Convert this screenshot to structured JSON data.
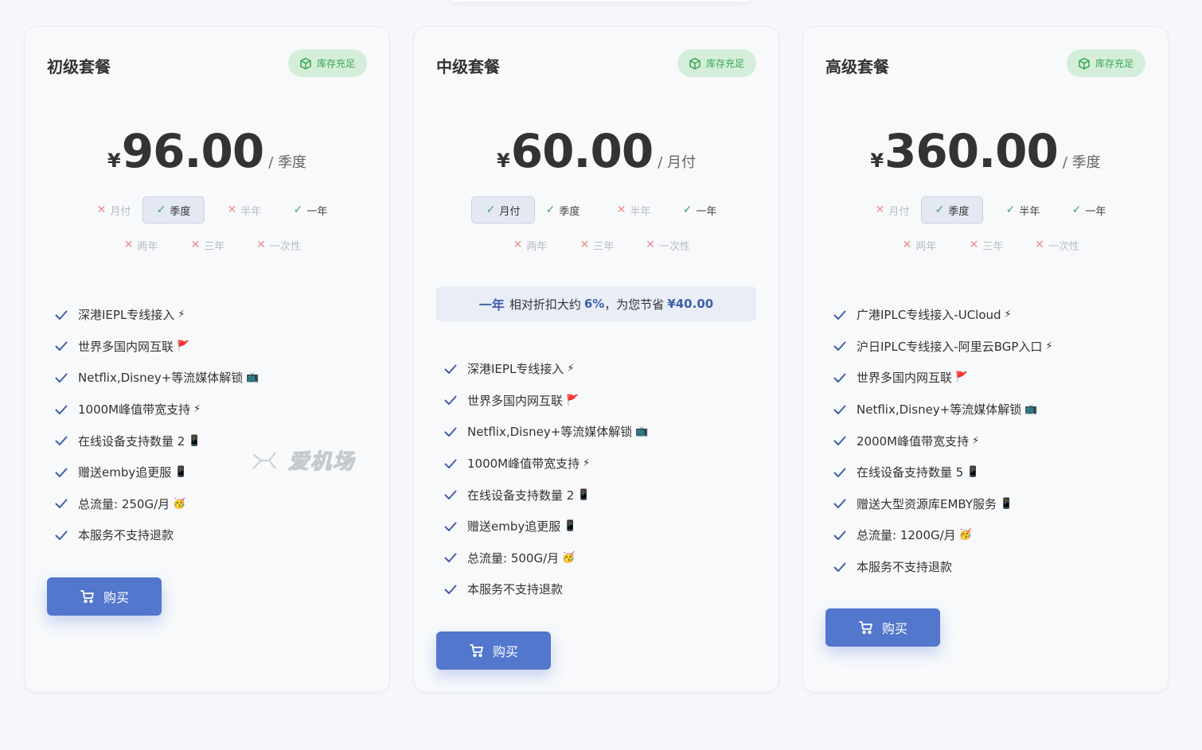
{
  "stock_label": "库存充足",
  "currency": "¥",
  "buy_label": "购买",
  "colors": {
    "accent": "#5277cc",
    "stock": "#3aa757",
    "unavailable": "#f08c8c"
  },
  "watermark": "爱机场",
  "plans": [
    {
      "title": "初级套餐",
      "price": "96.00",
      "period": "/ 季度",
      "cycles_row1": [
        {
          "label": "月付",
          "available": false,
          "active": false
        },
        {
          "label": "季度",
          "available": true,
          "active": true
        },
        {
          "label": "半年",
          "available": false,
          "active": false
        },
        {
          "label": "一年",
          "available": true,
          "active": false
        }
      ],
      "cycles_row2": [
        {
          "label": "两年",
          "available": false,
          "active": false
        },
        {
          "label": "三年",
          "available": false,
          "active": false
        },
        {
          "label": "一次性",
          "available": false,
          "active": false
        }
      ],
      "features": [
        {
          "text": "深港IEPL专线接入",
          "emoji": "⚡"
        },
        {
          "text": "世界多国内网互联",
          "emoji": "🚩"
        },
        {
          "text": "Netflix,Disney+等流媒体解锁",
          "emoji": "📺"
        },
        {
          "text": "1000M峰值带宽支持",
          "emoji": "⚡"
        },
        {
          "text": "在线设备支持数量 2",
          "emoji": "📱"
        },
        {
          "text": "赠送emby追更服",
          "emoji": "📱"
        },
        {
          "text": "总流量: 250G/月",
          "emoji": "🥳"
        },
        {
          "text": "本服务不支持退款",
          "emoji": ""
        }
      ]
    },
    {
      "title": "中级套餐",
      "price": "60.00",
      "period": "/ 月付",
      "cycles_row1": [
        {
          "label": "月付",
          "available": true,
          "active": true
        },
        {
          "label": "季度",
          "available": true,
          "active": false
        },
        {
          "label": "半年",
          "available": false,
          "active": false
        },
        {
          "label": "一年",
          "available": true,
          "active": false
        }
      ],
      "cycles_row2": [
        {
          "label": "两年",
          "available": false,
          "active": false
        },
        {
          "label": "三年",
          "available": false,
          "active": false
        },
        {
          "label": "一次性",
          "available": false,
          "active": false
        }
      ],
      "discount": {
        "cycle": "一年",
        "text1": "相对折扣大约",
        "percent": "6%",
        "text2": "，为您节省",
        "amount": "¥40.00"
      },
      "features": [
        {
          "text": "深港IEPL专线接入",
          "emoji": "⚡"
        },
        {
          "text": "世界多国内网互联",
          "emoji": "🚩"
        },
        {
          "text": "Netflix,Disney+等流媒体解锁",
          "emoji": "📺"
        },
        {
          "text": "1000M峰值带宽支持",
          "emoji": "⚡"
        },
        {
          "text": "在线设备支持数量 2",
          "emoji": "📱"
        },
        {
          "text": "赠送emby追更服",
          "emoji": "📱"
        },
        {
          "text": "总流量: 500G/月",
          "emoji": "🥳"
        },
        {
          "text": "本服务不支持退款",
          "emoji": ""
        }
      ]
    },
    {
      "title": "高级套餐",
      "price": "360.00",
      "period": "/ 季度",
      "cycles_row1": [
        {
          "label": "月付",
          "available": false,
          "active": false
        },
        {
          "label": "季度",
          "available": true,
          "active": true
        },
        {
          "label": "半年",
          "available": true,
          "active": false
        },
        {
          "label": "一年",
          "available": true,
          "active": false
        }
      ],
      "cycles_row2": [
        {
          "label": "两年",
          "available": false,
          "active": false
        },
        {
          "label": "三年",
          "available": false,
          "active": false
        },
        {
          "label": "一次性",
          "available": false,
          "active": false
        }
      ],
      "features": [
        {
          "text": "广港IPLC专线接入-UCloud",
          "emoji": "⚡"
        },
        {
          "text": "沪日IPLC专线接入-阿里云BGP入口",
          "emoji": "⚡"
        },
        {
          "text": "世界多国内网互联",
          "emoji": "🚩"
        },
        {
          "text": "Netflix,Disney+等流媒体解锁",
          "emoji": "📺"
        },
        {
          "text": "2000M峰值带宽支持",
          "emoji": "⚡"
        },
        {
          "text": "在线设备支持数量 5",
          "emoji": "📱"
        },
        {
          "text": "赠送大型资源库EMBY服务",
          "emoji": "📱"
        },
        {
          "text": "总流量: 1200G/月",
          "emoji": "🥳"
        },
        {
          "text": "本服务不支持退款",
          "emoji": ""
        }
      ]
    }
  ]
}
